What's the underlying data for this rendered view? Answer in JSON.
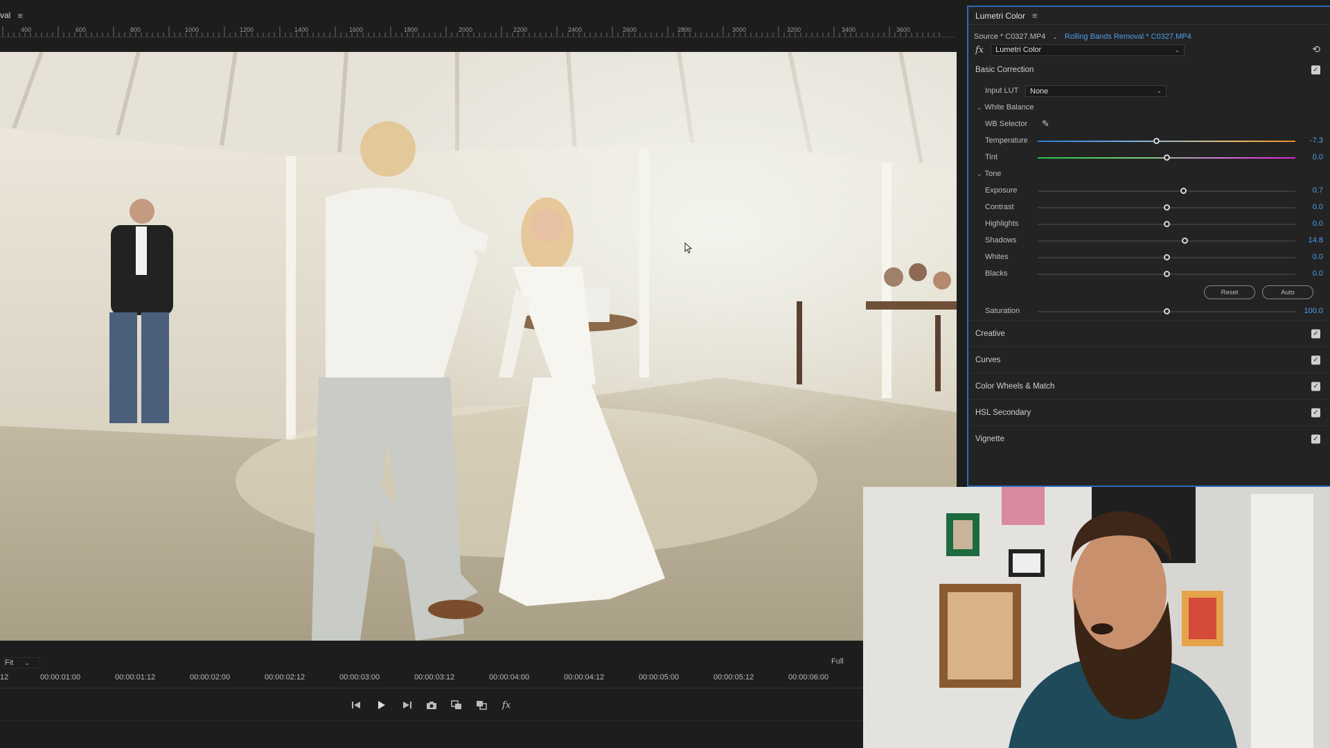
{
  "monitor": {
    "title": "val",
    "menu_glyph": "≡",
    "ruler_ticks": [
      "400",
      "600",
      "800",
      "1000",
      "1200",
      "1400",
      "1600",
      "1800",
      "2000",
      "2200",
      "2400",
      "2600",
      "2800",
      "3000",
      "3200",
      "3400",
      "3600"
    ],
    "fit_label": "Fit",
    "full_label": "Full",
    "timeline_labels": [
      "12",
      "00:00:01:00",
      "00:00:01:12",
      "00:00:02:00",
      "00:00:02:12",
      "00:00:03:00",
      "00:00:03:12",
      "00:00:04:00",
      "00:00:04:12",
      "00:00:05:00",
      "00:00:05:12",
      "00:00:06:00"
    ]
  },
  "lumetri": {
    "title": "Lumetri Color",
    "menu_glyph": "≡",
    "source": "Source * C0327.MP4",
    "sequence": "Rolling Bands Removal * C0327.MP4",
    "fx_glyph": "fx",
    "effect": "Lumetri Color",
    "basic_correction": "Basic Correction",
    "input_lut_label": "Input LUT",
    "input_lut_value": "None",
    "white_balance": "White Balance",
    "wb_selector": "WB Selector",
    "tone": "Tone",
    "sliders": [
      {
        "label": "Temperature",
        "value": "-7.3",
        "pos": 0.46
      },
      {
        "label": "Tint",
        "value": "0.0",
        "pos": 0.5
      },
      {
        "label": "Exposure",
        "value": "0.7",
        "pos": 0.565
      },
      {
        "label": "Contrast",
        "value": "0.0",
        "pos": 0.5
      },
      {
        "label": "Highlights",
        "value": "0.0",
        "pos": 0.5
      },
      {
        "label": "Shadows",
        "value": "14.8",
        "pos": 0.57
      },
      {
        "label": "Whites",
        "value": "0.0",
        "pos": 0.5
      },
      {
        "label": "Blacks",
        "value": "0.0",
        "pos": 0.5
      },
      {
        "label": "Saturation",
        "value": "100.0",
        "pos": 0.5
      }
    ],
    "reset_label": "Reset",
    "auto_label": "Auto",
    "sections": [
      "Creative",
      "Curves",
      "Color Wheels & Match",
      "HSL Secondary",
      "Vignette"
    ]
  },
  "colors": {
    "accent": "#4f9fe8",
    "panel_border": "#2d6bb6"
  }
}
